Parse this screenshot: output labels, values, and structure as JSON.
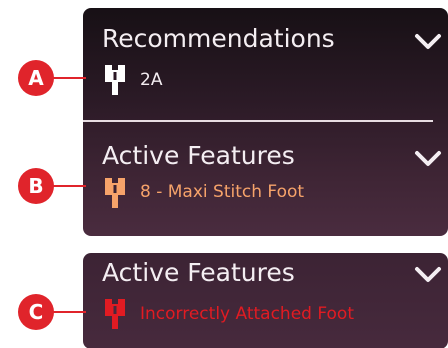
{
  "sections": [
    {
      "title": "Recommendations",
      "foot_label": "2A",
      "foot_color": "#ffffff",
      "label_color": "#f4eef2",
      "marker": "A"
    },
    {
      "title": "Active Features",
      "foot_label": "8 - Maxi Stitch Foot",
      "foot_color": "#f6a36a",
      "label_color": "#f6a36a",
      "marker": "B"
    },
    {
      "title": "Active Features",
      "foot_label": "Incorrectly Attached Foot",
      "foot_color": "#e11b22",
      "label_color": "#e11b22",
      "marker": "C"
    }
  ],
  "colors": {
    "marker": "#e0242b",
    "panel": "#3b2232",
    "divider": "#e7dde2"
  },
  "icons": {
    "expand": "chevron-down-icon",
    "presser_foot": "presser-foot-icon"
  }
}
